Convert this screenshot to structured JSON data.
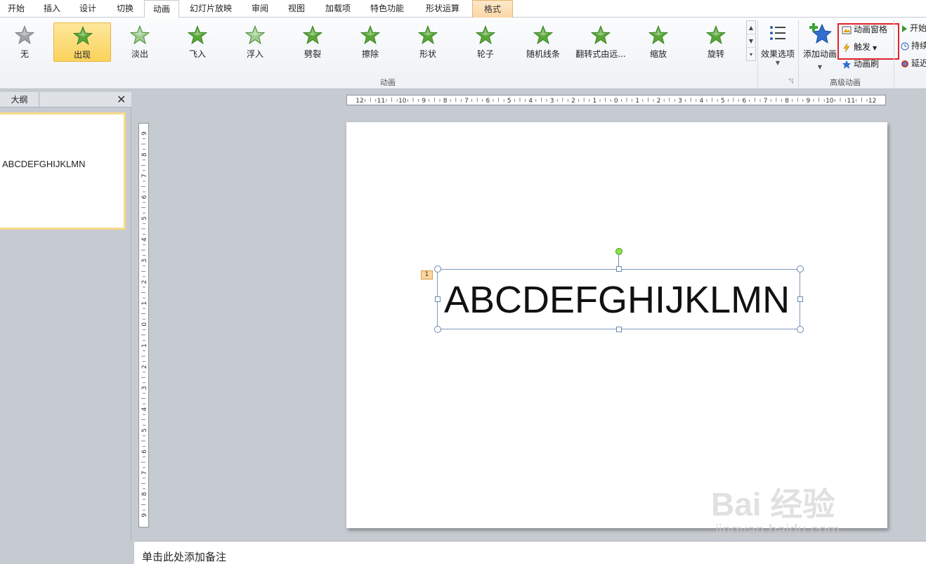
{
  "tabs": [
    {
      "label": "开始"
    },
    {
      "label": "插入"
    },
    {
      "label": "设计"
    },
    {
      "label": "切换"
    },
    {
      "label": "动画"
    },
    {
      "label": "幻灯片放映"
    },
    {
      "label": "审阅"
    },
    {
      "label": "视图"
    },
    {
      "label": "加载项"
    },
    {
      "label": "特色功能"
    },
    {
      "label": "形状运算"
    },
    {
      "label": "格式"
    }
  ],
  "active_tab": "动画",
  "animation_gallery": {
    "items": [
      {
        "label": "无",
        "icon": "gray-star-icon"
      },
      {
        "label": "出现",
        "icon": "star-appear-icon",
        "selected": true
      },
      {
        "label": "淡出",
        "icon": "star-fade-icon"
      },
      {
        "label": "飞入",
        "icon": "star-fly-in-icon"
      },
      {
        "label": "浮入",
        "icon": "star-float-in-icon"
      },
      {
        "label": "劈裂",
        "icon": "star-split-icon"
      },
      {
        "label": "擦除",
        "icon": "star-wipe-icon"
      },
      {
        "label": "形状",
        "icon": "star-shape-icon"
      },
      {
        "label": "轮子",
        "icon": "star-wheel-icon"
      },
      {
        "label": "随机线条",
        "icon": "star-random-bars-icon"
      },
      {
        "label": "翻转式由远...",
        "icon": "star-grow-turn-icon"
      },
      {
        "label": "缩放",
        "icon": "star-zoom-icon"
      },
      {
        "label": "旋转",
        "icon": "star-swivel-icon"
      }
    ],
    "group_label": "动画"
  },
  "effect_options": {
    "label": "效果选项"
  },
  "advanced": {
    "add_animation": "添加动画",
    "animation_pane": "动画窗格",
    "trigger": "触发",
    "animation_painter": "动画刷",
    "group_label": "高级动画"
  },
  "timing": {
    "start": "开始",
    "duration": "持续",
    "delay": "延迟"
  },
  "left_pane": {
    "outline_tab": "大纲",
    "close": "✕",
    "thumbnail_text": "ABCDEFGHIJKLMN"
  },
  "slide": {
    "text": "ABCDEFGHIJKLMN",
    "animation_badge": "1"
  },
  "ruler": {
    "h_labels": [
      "12",
      "11",
      "10",
      "9",
      "8",
      "7",
      "6",
      "5",
      "4",
      "3",
      "2",
      "1",
      "0",
      "1",
      "2",
      "3",
      "4",
      "5",
      "6",
      "7",
      "8",
      "9",
      "10",
      "11",
      "12"
    ],
    "v_labels": [
      "9",
      "8",
      "7",
      "6",
      "5",
      "4",
      "3",
      "2",
      "1",
      "0",
      "1",
      "2",
      "3",
      "4",
      "5",
      "6",
      "7",
      "8",
      "9"
    ]
  },
  "notes": {
    "placeholder": "单击此处添加备注"
  },
  "watermark": {
    "brand": "Bai 经验",
    "url": "jingyan.baidu.com"
  },
  "colors": {
    "star_green": "#5aa63a",
    "selected_bg": "#fbd35c",
    "highlight_box": "#e0232d"
  }
}
